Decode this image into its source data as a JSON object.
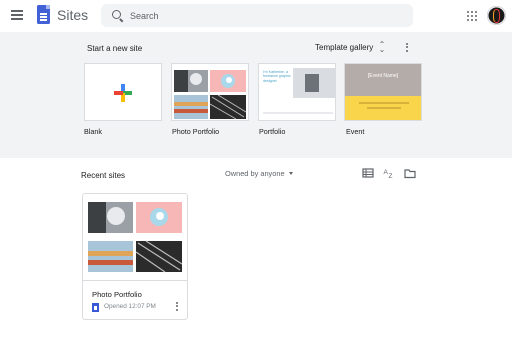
{
  "app": {
    "name": "Sites"
  },
  "search": {
    "placeholder": "Search"
  },
  "gallery": {
    "title": "Start a new site",
    "toggle_label": "Template gallery",
    "templates": [
      {
        "label": "Blank"
      },
      {
        "label": "Photo Portfolio"
      },
      {
        "label": "Portfolio"
      },
      {
        "label": "Event"
      }
    ],
    "portfolio_heading": "I'm Katherine, a freelance graphic designer",
    "event_heading": "[Event Name]"
  },
  "recent": {
    "title": "Recent sites",
    "owner_filter": "Owned by anyone",
    "sites": [
      {
        "name": "Photo Portfolio",
        "opened": "Opened 12:07 PM"
      }
    ]
  },
  "icons": {
    "menu": "menu-icon",
    "logo": "sites-logo-icon",
    "search": "search-icon",
    "apps": "apps-grid-icon",
    "unfold": "unfold-icon",
    "more": "more-vert-icon",
    "list_view": "list-view-icon",
    "sort": "sort-az-icon",
    "folder": "folder-icon"
  },
  "colors": {
    "accent": "#4361d6",
    "gallery_bg": "#f1f3f4",
    "plus_blue": "#4285f4",
    "plus_red": "#ea4335",
    "plus_yellow": "#fbbc04",
    "plus_green": "#34a853",
    "event_yellow": "#f9d54b",
    "photo_pink": "#f6b7b6"
  }
}
